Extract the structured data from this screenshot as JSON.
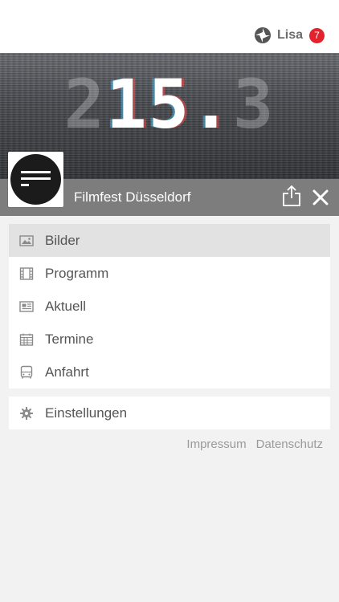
{
  "header": {
    "user_name": "Lisa",
    "notification_count": "7",
    "hub_icon": "hub-icon"
  },
  "banner": {
    "text_prefix": "2",
    "text_main": "15.",
    "text_suffix": "3"
  },
  "title_bar": {
    "title": "Filmfest Düsseldorf",
    "share_icon": "share-icon",
    "close_icon": "close-icon"
  },
  "menu": {
    "items": [
      {
        "label": "Bilder",
        "icon": "image-icon",
        "active": true
      },
      {
        "label": "Programm",
        "icon": "film-icon",
        "active": false
      },
      {
        "label": "Aktuell",
        "icon": "newspaper-icon",
        "active": false
      },
      {
        "label": "Termine",
        "icon": "calendar-icon",
        "active": false
      },
      {
        "label": "Anfahrt",
        "icon": "bus-icon",
        "active": false
      }
    ]
  },
  "settings": {
    "label": "Einstellungen",
    "icon": "gear-icon"
  },
  "footer": {
    "impressum": "Impressum",
    "datenschutz": "Datenschutz"
  },
  "colors": {
    "badge": "#e3222d",
    "title_bar": "#7d7d7d",
    "active_item": "#e2e2e2",
    "background": "#f2f2f2"
  }
}
